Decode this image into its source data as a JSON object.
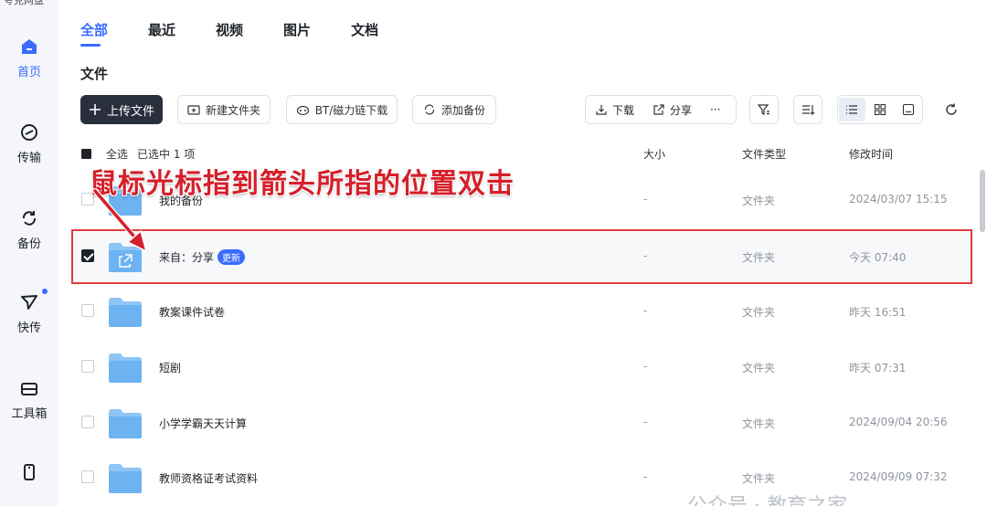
{
  "app": {
    "brand": "夸克网盘"
  },
  "sidebar": {
    "items": [
      {
        "label": "首页",
        "icon": "home-icon",
        "active": true
      },
      {
        "label": "传输",
        "icon": "transfer-icon"
      },
      {
        "label": "备份",
        "icon": "backup-icon"
      },
      {
        "label": "快传",
        "icon": "send-icon",
        "dot": true
      },
      {
        "label": "工具箱",
        "icon": "toolbox-icon"
      },
      {
        "label": "",
        "icon": "phone-icon"
      }
    ]
  },
  "tabs": [
    "全部",
    "最近",
    "视频",
    "图片",
    "文档"
  ],
  "section_title": "文件",
  "toolbar": {
    "upload": "上传文件",
    "new_folder": "新建文件夹",
    "bt": "BT/磁力链下载",
    "add_backup": "添加备份",
    "download": "下载",
    "share": "分享",
    "more": "···"
  },
  "table": {
    "select_all": "全选",
    "selected_info": "已选中 1 项",
    "col_size": "大小",
    "col_type": "文件类型",
    "col_time": "修改时间",
    "rows": [
      {
        "name": "我的备份",
        "size": "-",
        "type": "文件夹",
        "time": "2024/03/07 15:15",
        "checked": false
      },
      {
        "name": "来自：分享",
        "badge": "更新",
        "size": "-",
        "type": "文件夹",
        "time": "今天 07:40",
        "checked": true
      },
      {
        "name": "教案课件试卷",
        "size": "-",
        "type": "文件夹",
        "time": "昨天 16:51",
        "checked": false
      },
      {
        "name": "短剧",
        "size": "-",
        "type": "文件夹",
        "time": "昨天 07:31",
        "checked": false
      },
      {
        "name": "小学学霸天天计算",
        "size": "-",
        "type": "文件夹",
        "time": "2024/09/04 20:56",
        "checked": false
      },
      {
        "name": "教师资格证考试资料",
        "size": "-",
        "type": "文件夹",
        "time": "2024/09/09 07:32",
        "checked": false
      }
    ]
  },
  "annotation": "鼠标光标指到箭头所指的位置双击",
  "watermark": "公众号 · 教育之家",
  "colors": {
    "accent": "#3a6bff",
    "annotation": "#d4202a",
    "primary_button": "#2a2f3e"
  }
}
